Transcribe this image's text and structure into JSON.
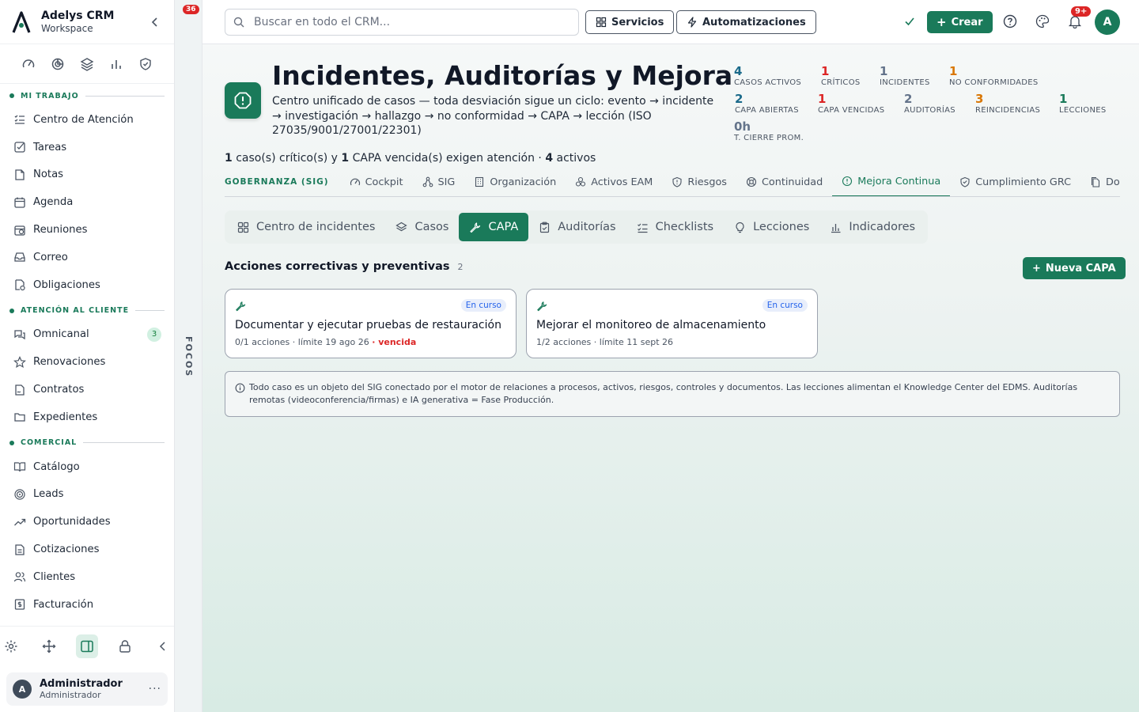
{
  "brand": {
    "title": "Adelys CRM",
    "subtitle": "Workspace"
  },
  "sidebar": {
    "sections": [
      {
        "label": "MI TRABAJO",
        "items": [
          {
            "label": "Centro de Atención",
            "icon": "list-check-icon"
          },
          {
            "label": "Tareas",
            "icon": "checkbox-icon"
          },
          {
            "label": "Notas",
            "icon": "note-icon"
          },
          {
            "label": "Agenda",
            "icon": "calendar-icon"
          },
          {
            "label": "Reuniones",
            "icon": "meeting-icon"
          },
          {
            "label": "Correo",
            "icon": "inbox-icon"
          },
          {
            "label": "Obligaciones",
            "icon": "obligation-icon"
          }
        ]
      },
      {
        "label": "ATENCIÓN AL CLIENTE",
        "items": [
          {
            "label": "Omnicanal",
            "icon": "chat-icon",
            "badge": "3"
          },
          {
            "label": "Renovaciones",
            "icon": "star-icon"
          },
          {
            "label": "Contratos",
            "icon": "contract-icon"
          },
          {
            "label": "Expedientes",
            "icon": "folder-icon"
          }
        ]
      },
      {
        "label": "COMERCIAL",
        "items": [
          {
            "label": "Catálogo",
            "icon": "book-icon"
          },
          {
            "label": "Leads",
            "icon": "target-icon"
          },
          {
            "label": "Oportunidades",
            "icon": "trend-icon"
          },
          {
            "label": "Cotizaciones",
            "icon": "quote-icon"
          },
          {
            "label": "Clientes",
            "icon": "users-icon"
          },
          {
            "label": "Facturación",
            "icon": "invoice-icon"
          }
        ]
      }
    ]
  },
  "user": {
    "initial": "A",
    "name": "Administrador",
    "role": "Administrador",
    "more": "···"
  },
  "focos": {
    "badge": "36",
    "label": "FOCOS"
  },
  "topbar": {
    "search_placeholder": "Buscar en todo el CRM...",
    "services_label": "Servicios",
    "automations_label": "Automatizaciones",
    "create_label": "Crear",
    "notif_badge": "9+",
    "avatar": "A"
  },
  "header": {
    "title": "Incidentes, Auditorías y Mejora",
    "description": "Centro unificado de casos — toda desviación sigue un ciclo: evento → incidente → investigación → hallazgo → no conformidad → CAPA → lección (ISO 27035/9001/27001/22301)"
  },
  "kpis": [
    {
      "value": "4",
      "label": "CASOS ACTIVOS",
      "color": "#1a6a8a"
    },
    {
      "value": "1",
      "label": "CRÍTICOS",
      "color": "#dc2626"
    },
    {
      "value": "1",
      "label": "INCIDENTES",
      "color": "#64748b"
    },
    {
      "value": "1",
      "label": "NO CONFORMIDADES",
      "color": "#d97706"
    },
    {
      "value": "2",
      "label": "CAPA ABIERTAS",
      "color": "#1a6a8a"
    },
    {
      "value": "1",
      "label": "CAPA VENCIDAS",
      "color": "#dc2626"
    },
    {
      "value": "2",
      "label": "AUDITORÍAS",
      "color": "#64748b"
    },
    {
      "value": "3",
      "label": "REINCIDENCIAS",
      "color": "#d97706"
    },
    {
      "value": "1",
      "label": "LECCIONES",
      "color": "#1a7a5a"
    },
    {
      "value": "0h",
      "label": "T. CIERRE PROM.",
      "color": "#64748b"
    }
  ],
  "alert": {
    "critical": "1",
    "critical_text": " caso(s) crítico(s) y ",
    "overdue": "1",
    "overdue_text": " CAPA vencida(s) exigen atención · ",
    "active": "4",
    "active_text": " activos"
  },
  "gov_tabs": {
    "label": "GOBERNANZA (SIG)",
    "items": [
      "Cockpit",
      "SIG",
      "Organización",
      "Activos EAM",
      "Riesgos",
      "Continuidad",
      "Mejora Continua",
      "Cumplimiento GRC",
      "Docu"
    ],
    "active": "Mejora Continua"
  },
  "sub_tabs": {
    "items": [
      "Centro de incidentes",
      "Casos",
      "CAPA",
      "Auditorías",
      "Checklists",
      "Lecciones",
      "Indicadores"
    ],
    "active": "CAPA"
  },
  "capa": {
    "title": "Acciones correctivas y preventivas",
    "count": "2",
    "new_label": "Nueva CAPA",
    "cards": [
      {
        "title": "Documentar y ejecutar pruebas de restauración",
        "status": "En curso",
        "actions": "0/1 acciones",
        "deadline": "· límite 19 ago 26",
        "overdue": "· vencida"
      },
      {
        "title": "Mejorar el monitoreo de almacenamiento",
        "status": "En curso",
        "actions": "1/2 acciones",
        "deadline": "· límite 11 sept 26",
        "overdue": ""
      }
    ]
  },
  "info": "Todo caso es un objeto del SIG conectado por el motor de relaciones a procesos, activos, riesgos, controles y documentos. Las lecciones alimentan el Knowledge Center del EDMS. Auditorías remotas (videoconferencia/firmas) e IA generativa = Fase Producción.",
  "colors": {
    "accent": "#1a7a5a",
    "danger": "#dc2626",
    "warning": "#d97706",
    "info": "#2563eb"
  }
}
